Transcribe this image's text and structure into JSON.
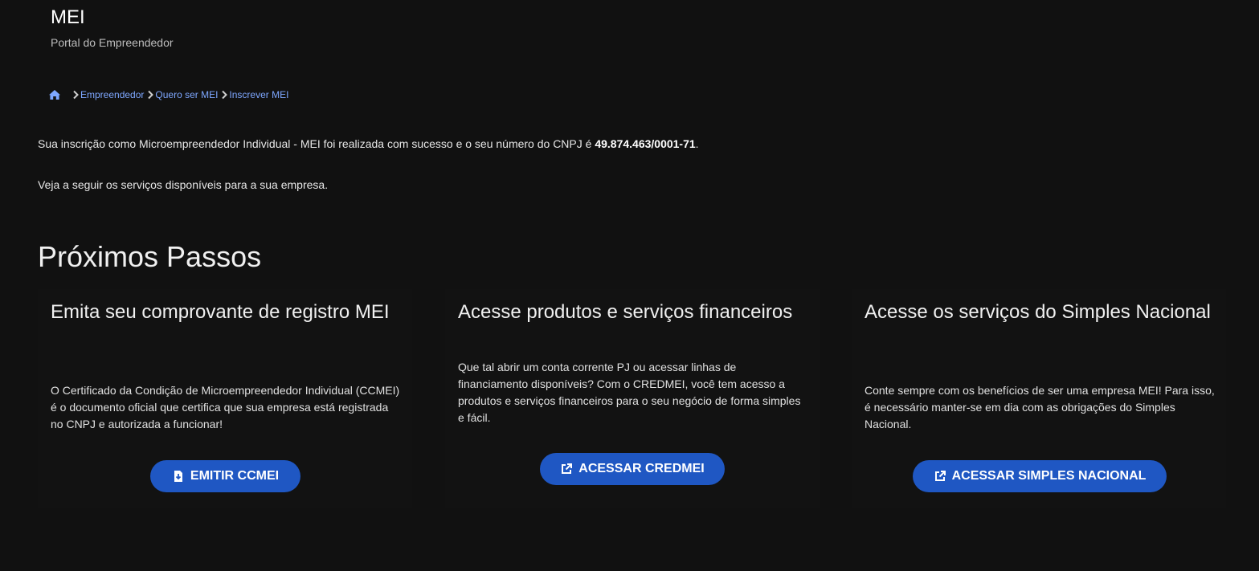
{
  "header": {
    "title": "MEI",
    "subtitle": "Portal do Empreendedor"
  },
  "breadcrumb": {
    "home_icon": "home-icon",
    "items": [
      "Empreendedor",
      "Quero ser MEI",
      "Inscrever MEI"
    ]
  },
  "message": {
    "registration_text": "Sua inscrição como Microempreendedor Individual - MEI foi realizada com sucesso e o seu número do CNPJ é ",
    "cnpj": "49.874.463/0001-71",
    "period": ".",
    "services_text": "Veja a seguir os serviços disponíveis para a sua empresa."
  },
  "next_steps": {
    "title": "Próximos Passos",
    "cards": [
      {
        "title": "Emita seu comprovante de registro MEI",
        "text": "O Certificado da Condição de Microempreendedor Individual (CCMEI) é o documento oficial que certifica que sua empresa está registrada no CNPJ e autorizada a funcionar!",
        "button_label": "EMITIR CCMEI",
        "button_icon": "file-download-icon"
      },
      {
        "title": "Acesse produtos e serviços financeiros",
        "text": "Que tal abrir um conta corrente PJ ou acessar linhas de financiamento disponíveis? Com o CREDMEI, você tem acesso a produtos e serviços financeiros para o seu negócio de forma simples e fácil.",
        "button_label": "ACESSAR CREDMEI",
        "button_icon": "external-link-icon"
      },
      {
        "title": "Acesse os serviços do Simples Nacional",
        "text": "Conte sempre com os benefícios de ser uma empresa MEI! Para isso, é necessário manter-se em dia com as obrigações do Simples Nacional.",
        "button_label": "ACESSAR SIMPLES NACIONAL",
        "button_icon": "external-link-icon"
      }
    ]
  },
  "colors": {
    "background": "#111111",
    "link": "#7ea7ff",
    "button": "#1f57c3",
    "text": "#e6e6e6"
  }
}
